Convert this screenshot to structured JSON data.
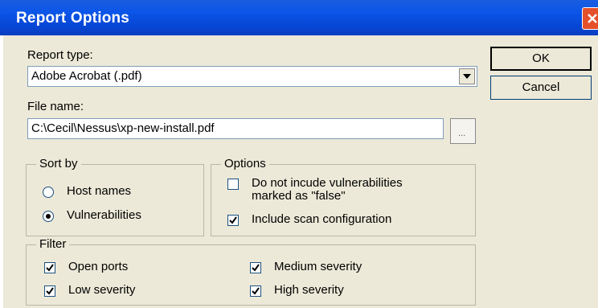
{
  "window": {
    "title": "Report Options"
  },
  "report_type": {
    "label": "Report type:",
    "value": "Adobe Acrobat (.pdf)"
  },
  "file_name": {
    "label": "File name:",
    "value": "C:\\Cecil\\Nessus\\xp-new-install.pdf",
    "browse_label": "..."
  },
  "buttons": {
    "ok": "OK",
    "cancel": "Cancel"
  },
  "sort_by": {
    "legend": "Sort by",
    "host_names": "Host names",
    "vulnerabilities": "Vulnerabilities",
    "selected": "Vulnerabilities"
  },
  "options": {
    "legend": "Options",
    "exclude_false_line1": "Do not incude vulnerabilities",
    "exclude_false_line2": "marked as \"false\"",
    "exclude_false_checked": false,
    "include_scan_config": "Include scan configuration",
    "include_scan_config_checked": true
  },
  "filter": {
    "legend": "Filter",
    "open_ports": "Open ports",
    "low_severity": "Low severity",
    "medium_severity": "Medium severity",
    "high_severity": "High severity",
    "all_checked": true
  },
  "colors": {
    "titlebar": "#0b55e8",
    "dialog_bg": "#ece9d8",
    "close": "#e4502a"
  }
}
